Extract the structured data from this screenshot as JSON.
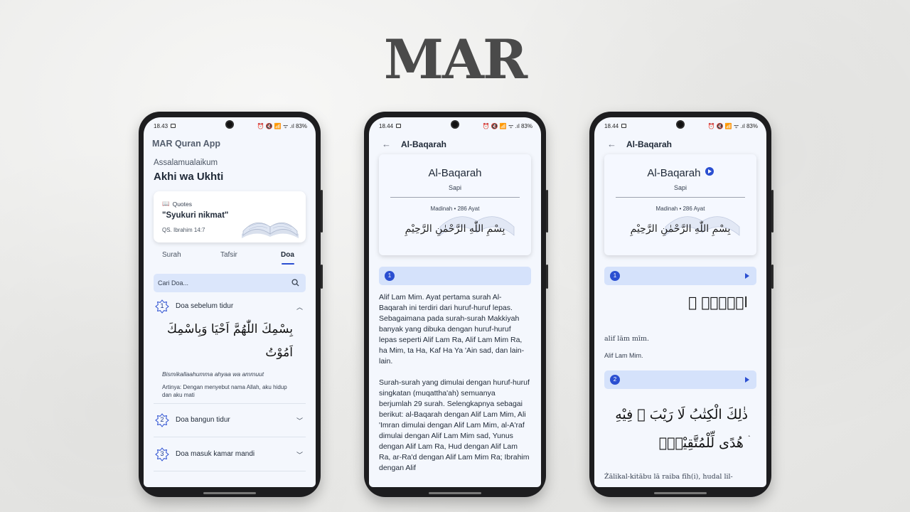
{
  "brand": {
    "logo": "MAR"
  },
  "phones": [
    {
      "status": {
        "time": "18.43",
        "icons": "⏰ 🔇 📶 ᯤ .ıl 83%"
      },
      "app_title": "MAR Quran App",
      "greeting": "Assalamualaikum",
      "greeting_name": "Akhi wa Ukhti",
      "quote": {
        "label": "Quotes",
        "text": "\"Syukuri nikmat\"",
        "ref": "QS. Ibrahim 14:7"
      },
      "tabs": [
        "Surah",
        "Tafsir",
        "Doa"
      ],
      "active_tab": "Doa",
      "search": {
        "placeholder": "Cari Doa..."
      },
      "doa": [
        {
          "num": "1",
          "title": "Doa sebelum tidur",
          "arabic": "بِسْمِكَ اللّٰهُمَّ اَحْيَا وَبِاسْمِكَ اَمُوْتُ",
          "latin": "Bismikallaahumma ahyaa wa ammuut",
          "arti": "Artinya: Dengan menyebut nama Allah, aku hidup dan aku mati"
        },
        {
          "num": "2",
          "title": "Doa bangun tidur"
        },
        {
          "num": "3",
          "title": "Doa masuk kamar mandi"
        }
      ]
    },
    {
      "status": {
        "time": "18.44",
        "icons": "⏰ 🔇 📶 ᯤ .ıl 83%"
      },
      "header": "Al-Baqarah",
      "surah": {
        "name": "Al-Baqarah",
        "meaning": "Sapi",
        "meta": "Madinah • 286 Ayat",
        "bismillah": "بِسْمِ اللّٰهِ الرَّحْمٰنِ الرَّحِيْمِ"
      },
      "ayah_num": "1",
      "tafsir": [
        "Alif Lam Mim. Ayat pertama surah Al-Baqarah ini terdiri dari huruf-huruf lepas. Sebagaimana pada surah-surah Makkiyah banyak yang dibuka dengan huruf-huruf lepas seperti Alif Lam Ra, Alif Lam Mim Ra, ha Mim, ta Ha, Kaf Ha Ya 'Ain sad, dan lain-lain.",
        "Surah-surah yang dimulai dengan huruf-huruf singkatan (muqattha'ah) semuanya berjumlah 29 surah. Selengkapnya sebagai berikut: al-Baqarah dengan Alif Lam Mim, Ali 'Imran dimulai dengan Alif Lam Mim, al-A'raf dimulai dengan Alif Lam Mim sad, Yunus dengan Alif Lam Ra, Hud dengan Alif Lam Ra, ar-Ra'd dengan Alif Lam Mim Ra; Ibrahim dengan Alif"
      ]
    },
    {
      "status": {
        "time": "18.44",
        "icons": "⏰ 🔇 📶 ᯤ .ıl 83%"
      },
      "header": "Al-Baqarah",
      "surah": {
        "name": "Al-Baqarah",
        "meaning": "Sapi",
        "meta": "Madinah • 286 Ayat",
        "bismillah": "بِسْمِ اللّٰهِ الرَّحْمٰنِ الرَّحِيْمِ"
      },
      "ayat": [
        {
          "num": "1",
          "arabic": "الۤمّۤ ۚ",
          "translit": "alif lām mīm.",
          "translation": "Alif Lam Mim."
        },
        {
          "num": "2",
          "arabic": "ذٰلِكَ الْكِتٰبُ لَا رَيْبَ ۛ فِيْهِ ۛ هُدًى لِّلْمُتَّقِيْنَۙ",
          "translit": "Żālikal-kitābu lā raiba fīh(i), hudal lil-"
        }
      ]
    }
  ]
}
